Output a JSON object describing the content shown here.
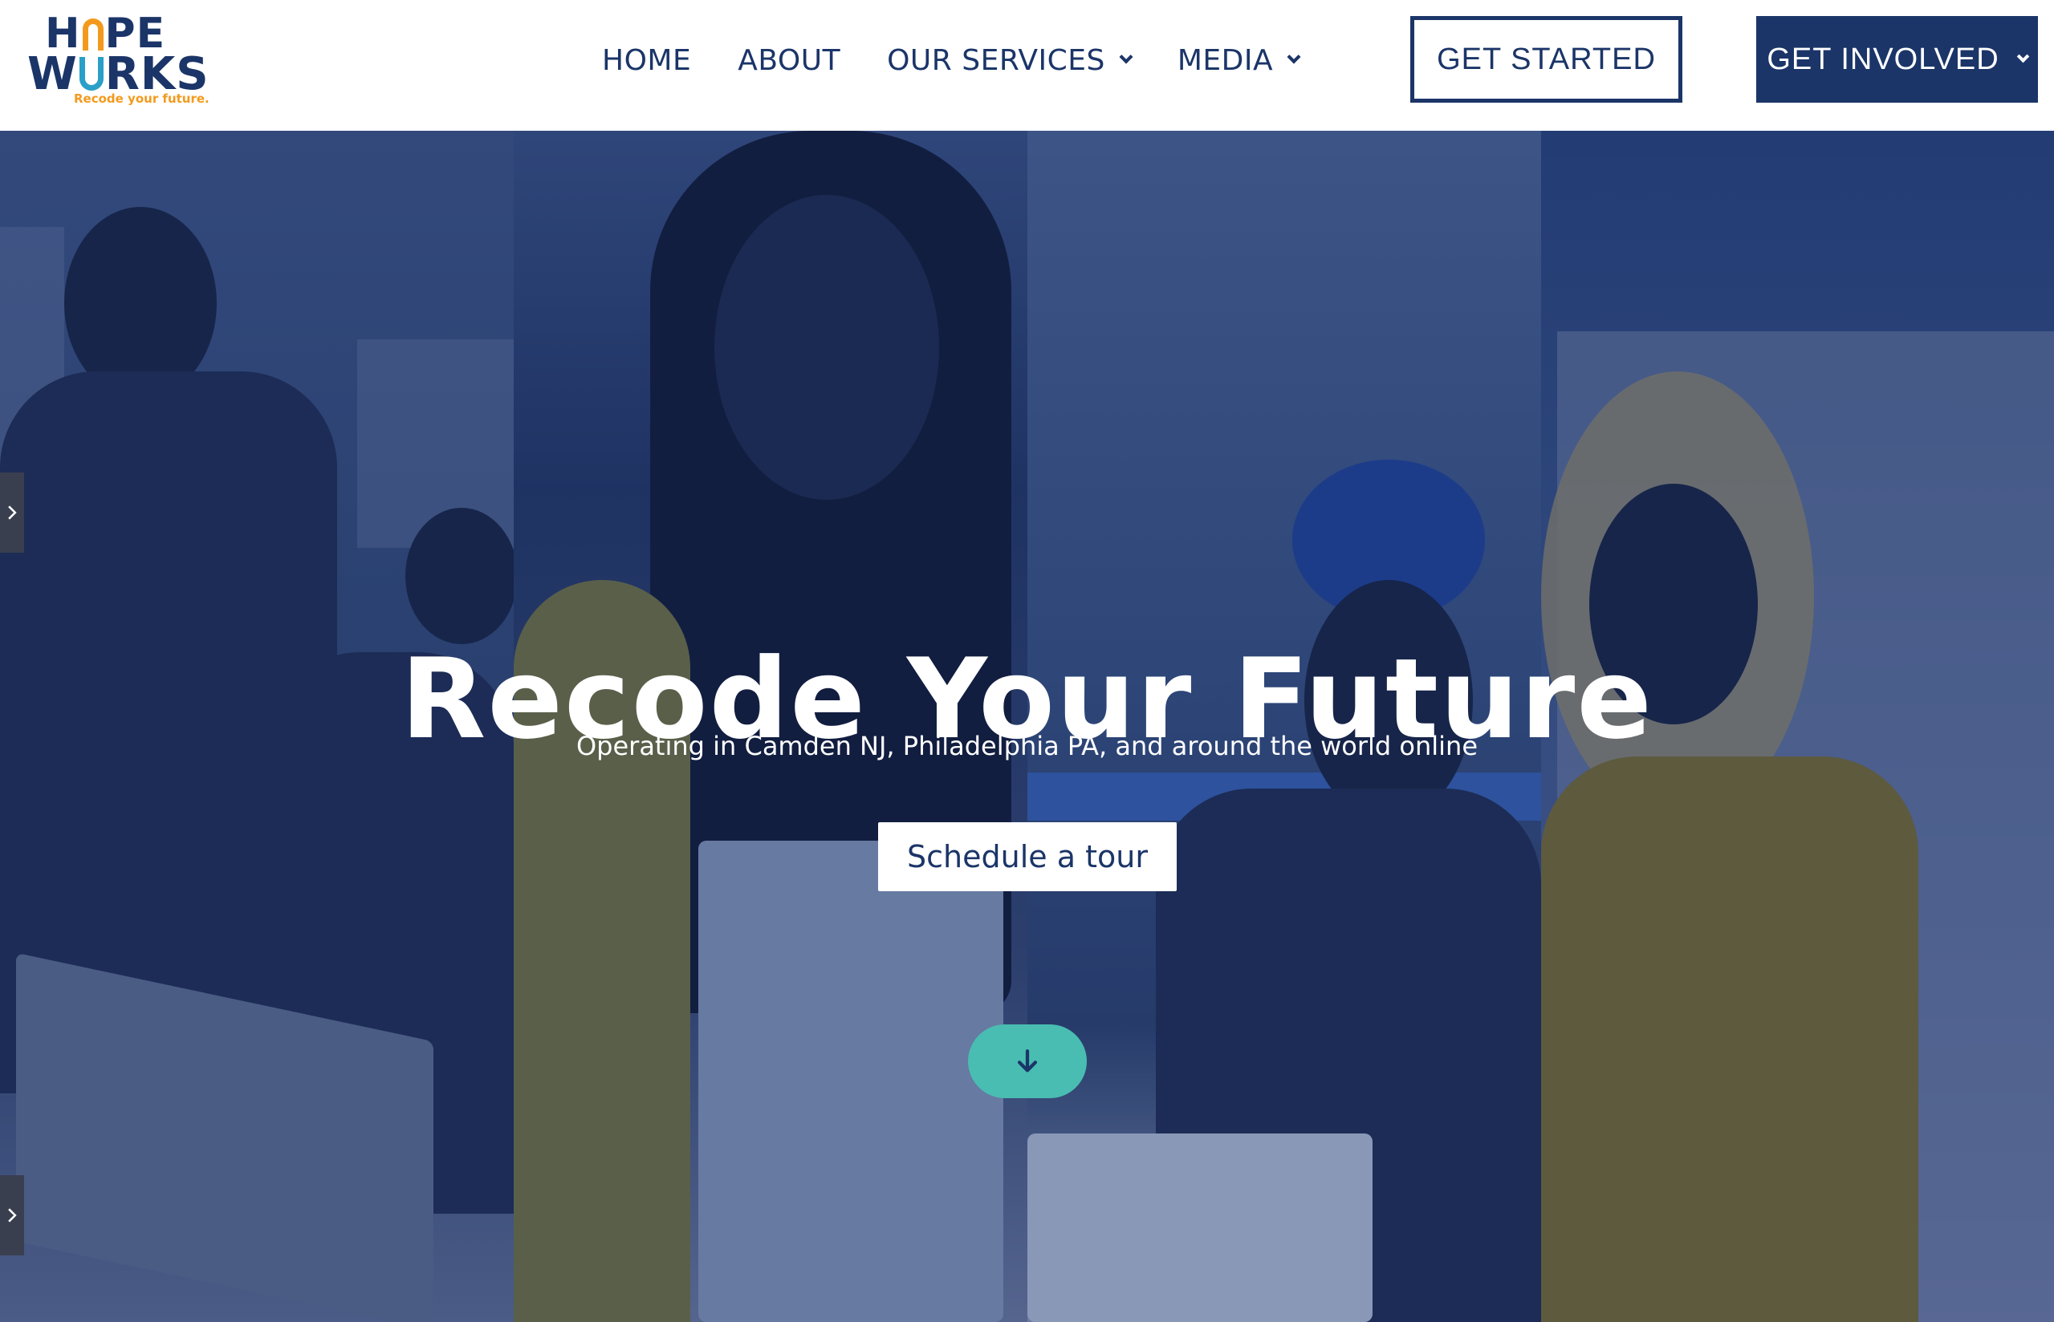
{
  "logo": {
    "line1": "H",
    "line1_rest": "PE",
    "line2": "W",
    "line2_rest": "RKS",
    "tagline": "Recode your future."
  },
  "nav": {
    "items": [
      {
        "label": "HOME",
        "has_dropdown": false
      },
      {
        "label": "ABOUT",
        "has_dropdown": false
      },
      {
        "label": "OUR SERVICES",
        "has_dropdown": true
      },
      {
        "label": "MEDIA",
        "has_dropdown": true
      }
    ],
    "get_started": "GET STARTED",
    "get_involved": "GET INVOLVED"
  },
  "hero": {
    "title": "Recode Your Future",
    "subtitle": "Operating in Camden NJ, Philadelphia PA, and around the world online",
    "cta": "Schedule a tour"
  },
  "icons": {
    "scroll_down": "arrow-down-icon",
    "side_tabs": "chevron-right-icon"
  },
  "colors": {
    "brand_navy": "#1b3568",
    "brand_orange": "#f39a1d",
    "brand_blue": "#2aa0c8",
    "accent_teal": "#49bdb1",
    "hero_overlay": "#2d467c"
  }
}
